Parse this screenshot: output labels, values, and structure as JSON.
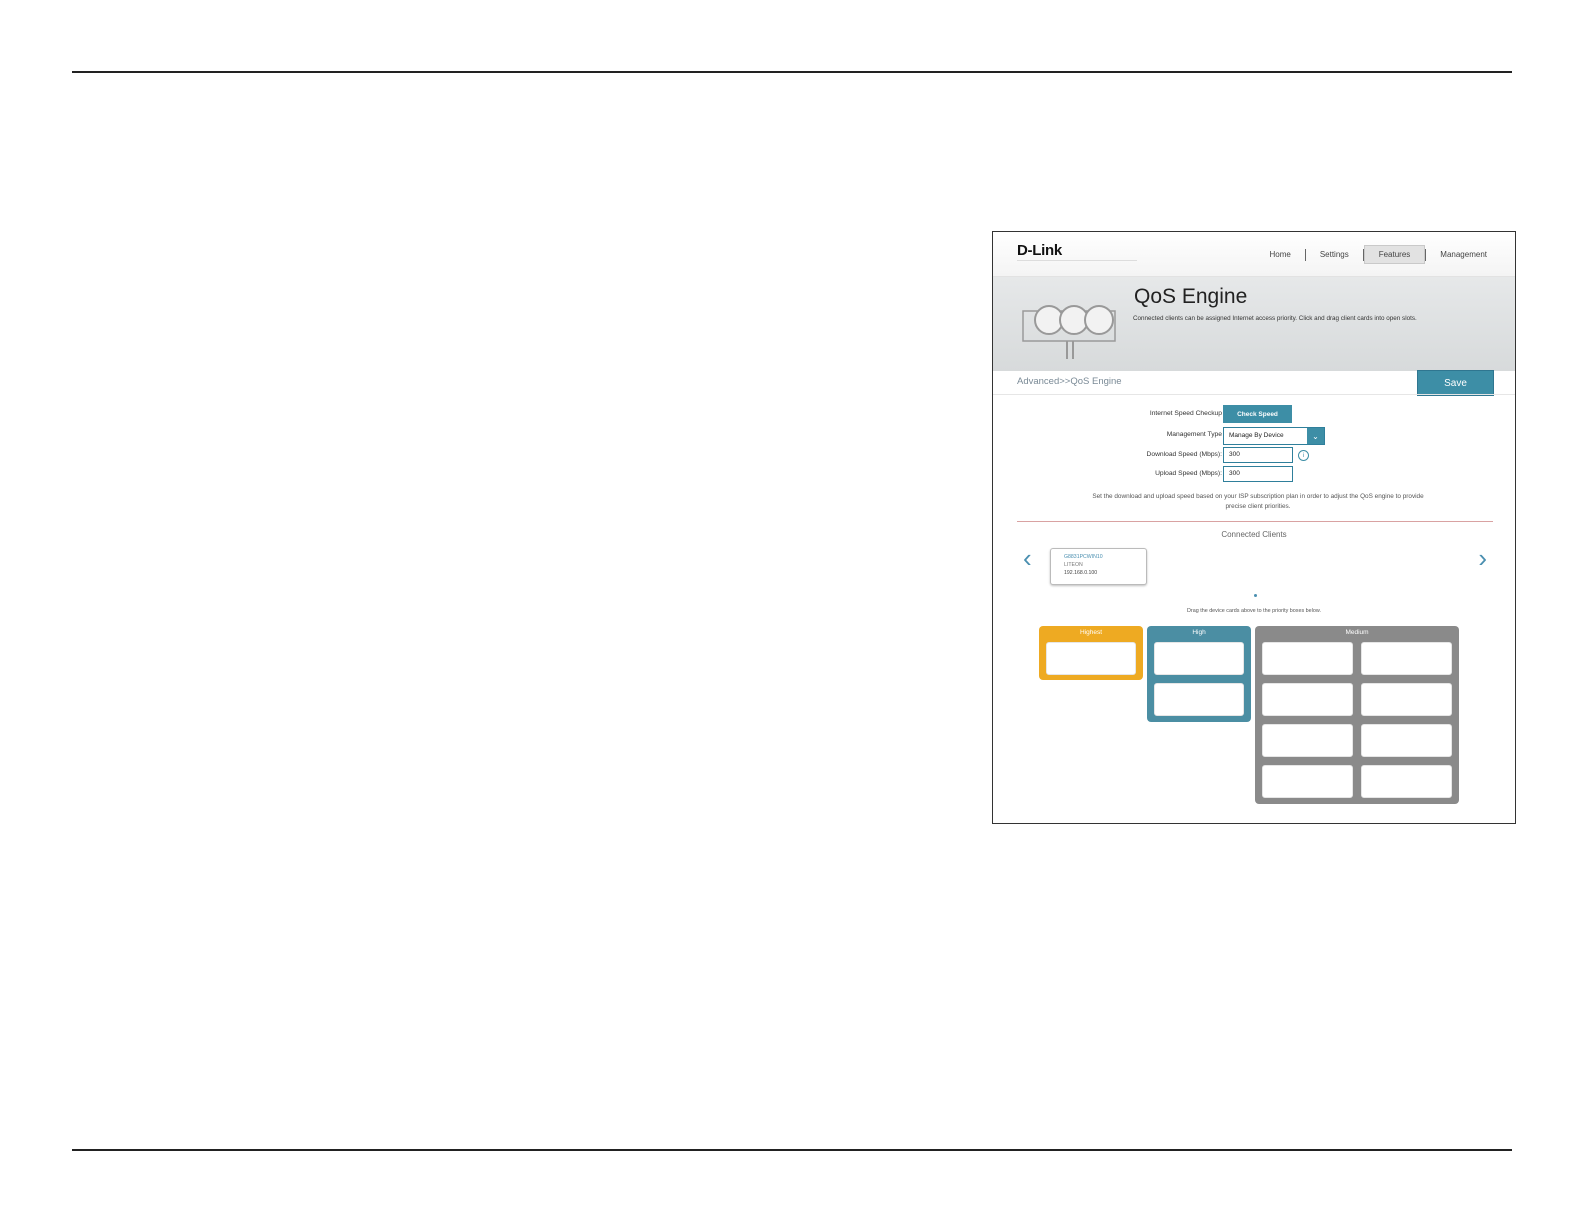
{
  "nav": {
    "logo": "D-Link",
    "items": [
      {
        "label": "Home"
      },
      {
        "label": "Settings"
      },
      {
        "label": "Features",
        "active": true
      },
      {
        "label": "Management"
      }
    ]
  },
  "banner": {
    "title": "QoS Engine",
    "description": "Connected clients can be assigned Internet access priority. Click and drag client cards into open slots."
  },
  "breadcrumb": "Advanced>>QoS Engine",
  "save_label": "Save",
  "form": {
    "speed_checkup_label": "Internet Speed Checkup",
    "check_speed_button": "Check Speed",
    "management_type_label": "Management Type",
    "management_type_value": "Manage By Device",
    "download_label": "Download Speed (Mbps):",
    "download_value": "300",
    "upload_label": "Upload Speed (Mbps):",
    "upload_value": "300",
    "note": "Set the download and upload speed based on your ISP subscription plan in order to adjust the QoS engine to provide precise client priorities."
  },
  "connected_clients": {
    "title": "Connected Clients",
    "clients": [
      {
        "name": "G8831PCWIN10",
        "vendor": "LITEON",
        "ip": "192.168.0.100"
      }
    ],
    "drag_note": "Drag the device cards above to the priority boxes below."
  },
  "priority": {
    "highest": "Highest",
    "high": "High",
    "medium": "Medium"
  },
  "colors": {
    "accent": "#3d8ea6",
    "highest": "#eeaa22",
    "high": "#4b8ea3",
    "medium": "#8a8a8a"
  },
  "icons": [
    "info-icon",
    "chevron-left-icon",
    "chevron-right-icon",
    "chevron-down-icon"
  ]
}
